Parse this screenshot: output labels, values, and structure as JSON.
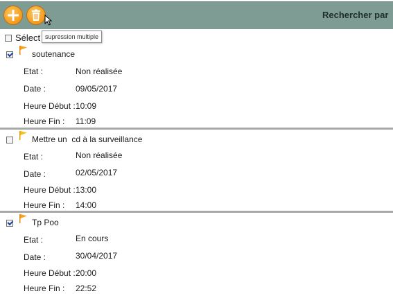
{
  "toolbar": {
    "search_title": "Rechercher par",
    "add_icon": "plus-icon",
    "delete_icon": "trash-icon",
    "tooltip": "supression multiple",
    "accent_color": "#f29a1e",
    "bar_color": "#7e9c93"
  },
  "select_all": {
    "label": "Sélect",
    "checked": false
  },
  "field_labels": {
    "etat": "Etat :",
    "date": "Date :",
    "heure_debut": "Heure Début :",
    "heure_fin": "Heure Fin :"
  },
  "tasks": [
    {
      "title": "soutenance",
      "checked": true,
      "etat": "Non réalisée",
      "date": "09/05/2017",
      "heure_debut": "10:09",
      "heure_fin": "11:09"
    },
    {
      "title": "Mettre un  cd à la surveillance",
      "checked": false,
      "etat": "Non réalisée",
      "date": "02/05/2017",
      "heure_debut": "13:00",
      "heure_fin": "14:00"
    },
    {
      "title": "Tp Poo",
      "checked": true,
      "etat": "En cours",
      "date": "30/04/2017",
      "heure_debut": "20:00",
      "heure_fin": "22:52"
    }
  ]
}
